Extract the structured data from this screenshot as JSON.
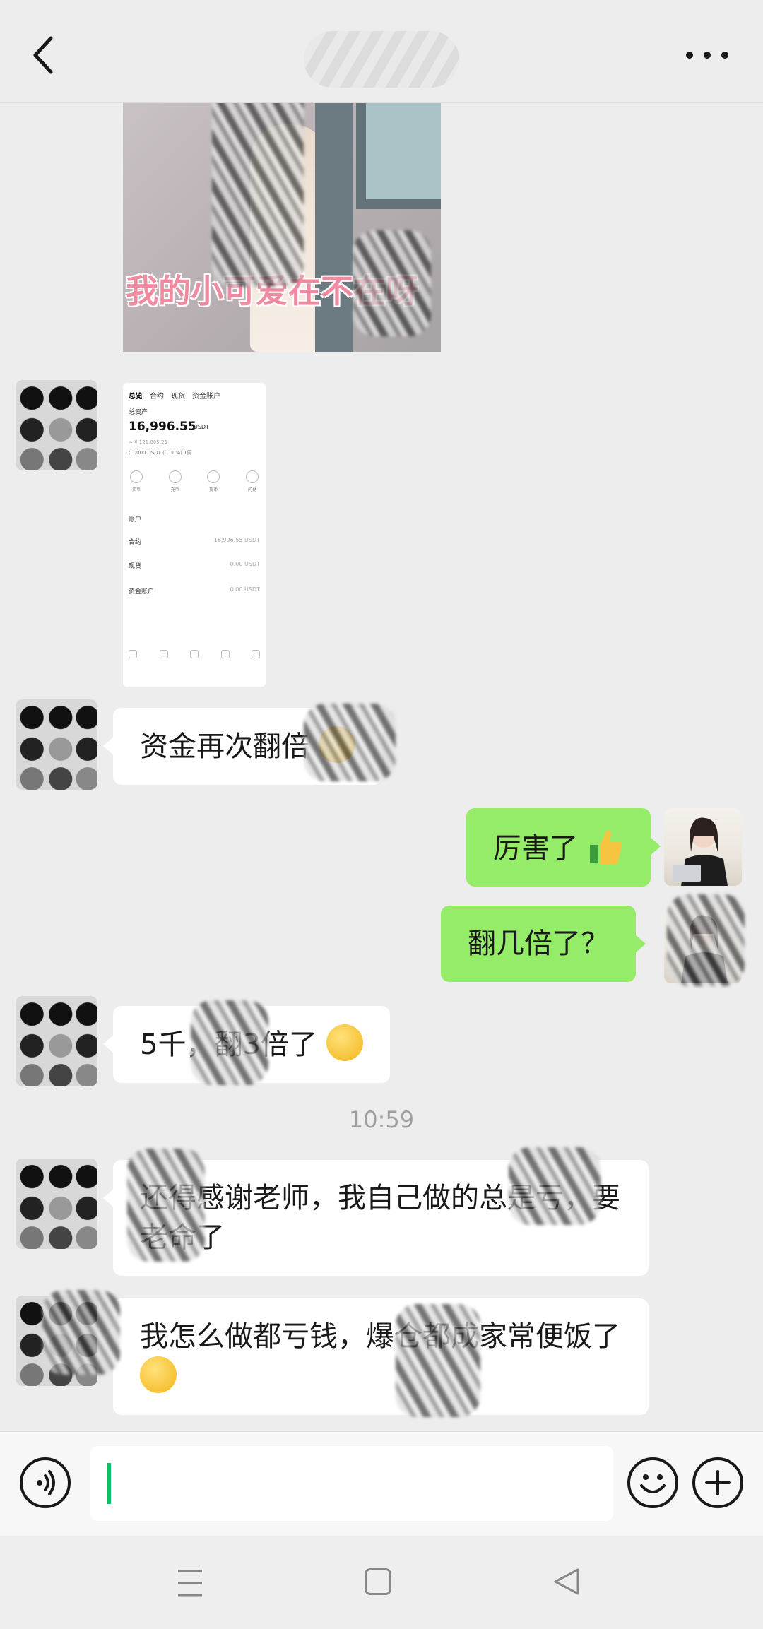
{
  "header": {
    "title": ""
  },
  "messages": {
    "photo_caption": "我的小可爱在不在呀",
    "screenshot": {
      "tabs": [
        "总览",
        "合约",
        "现货",
        "资金账户"
      ],
      "total_label": "总资产",
      "total_value": "16,996.55",
      "total_unit": "USDT",
      "approx": "≈ ¥ 121,005.25",
      "pnl": "0.0000 USDT (0.00%) 1周",
      "actions": [
        "买币",
        "充币",
        "提币",
        "闪兑"
      ],
      "section": "账户",
      "rows": [
        {
          "name": "合约",
          "value": "16,996.55 USDT"
        },
        {
          "name": "现货",
          "value": "0.00 USDT"
        },
        {
          "name": "资金账户",
          "value": "0.00 USDT"
        }
      ]
    },
    "m1": "资金再次翻倍",
    "m2": "厉害了",
    "m3": "翻几倍了？",
    "m4": "5千，翻3倍了",
    "timestamp": "10:59",
    "m5": "还得感谢老师，我自己做的总是亏，要老命了",
    "m6": "我怎么做都亏钱，爆仓都成家常便饭了"
  },
  "input": {
    "value": "",
    "placeholder": ""
  },
  "colors": {
    "bg": "#ededed",
    "me_bubble": "#95ec69",
    "other_bubble": "#ffffff",
    "caret": "#07c160"
  }
}
